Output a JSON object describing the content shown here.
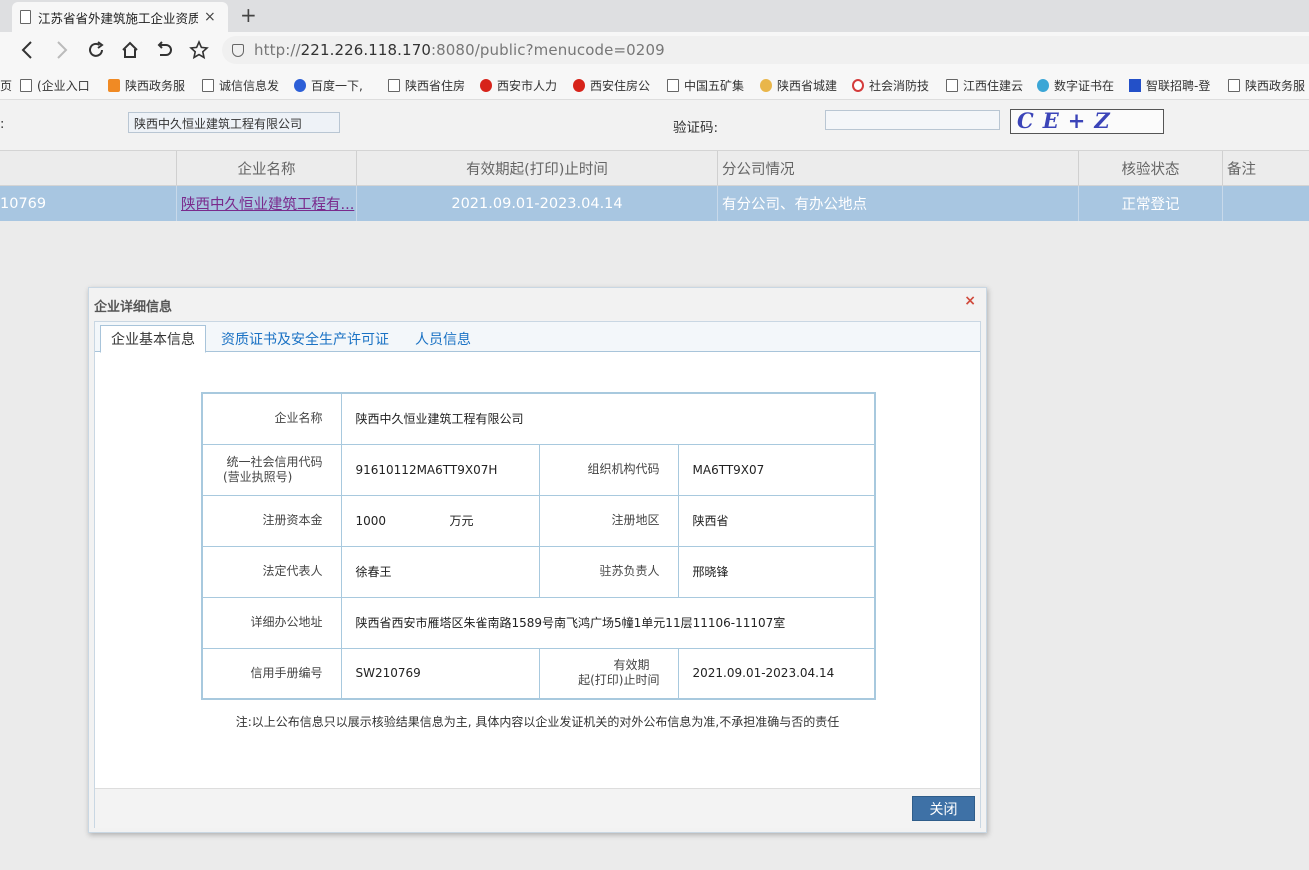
{
  "browser": {
    "tab_title": "江苏省省外建筑施工企业资质",
    "tab_close": "×",
    "new_tab": "+",
    "url_prefix": "http://",
    "url_host": "221.226.118.170",
    "url_rest": ":8080/public?menucode=0209",
    "bookmarks": [
      {
        "label": "(企业入口",
        "icon": "doc-icon"
      },
      {
        "label": "陕西政务服",
        "icon": "orange-icon"
      },
      {
        "label": "诚信信息发",
        "icon": "doc-icon"
      },
      {
        "label": "百度一下,",
        "icon": "paw-icon"
      },
      {
        "label": "陕西省住房",
        "icon": "doc-icon"
      },
      {
        "label": "西安市人力",
        "icon": "emblem-icon"
      },
      {
        "label": "西安住房公",
        "icon": "emblem-icon"
      },
      {
        "label": "中国五矿集",
        "icon": "doc-icon"
      },
      {
        "label": "陕西省城建",
        "icon": "swirl-icon"
      },
      {
        "label": "社会消防技",
        "icon": "fire-icon"
      },
      {
        "label": "江西住建云",
        "icon": "doc-icon"
      },
      {
        "label": "数字证书在",
        "icon": "cert-icon"
      },
      {
        "label": "智联招聘-登",
        "icon": "zl-icon"
      },
      {
        "label": "陕西政务服",
        "icon": "doc-icon"
      }
    ]
  },
  "search": {
    "label": ":",
    "company_value": "陕西中久恒业建筑工程有限公司",
    "captcha_label": "验证码:",
    "captcha_text": "CE+Z"
  },
  "results": {
    "headers": [
      "企业名称",
      "有效期起(打印)止时间",
      "分公司情况",
      "核验状态",
      "备注"
    ],
    "row": {
      "id": "10769",
      "name": "陕西中久恒业建筑工程有...",
      "period": "2021.09.01-2023.04.14",
      "branch": "有分公司、有办公地点",
      "status": "正常登记",
      "remark": ""
    }
  },
  "dialog": {
    "title": "企业详细信息",
    "close_icon": "×",
    "tabs": [
      "企业基本信息",
      "资质证书及安全生产许可证",
      "人员信息"
    ],
    "fields": {
      "name_label": "企业名称",
      "name_value": "陕西中久恒业建筑工程有限公司",
      "credit_label_1": "统一社会信用代码",
      "credit_label_2": "(营业执照号)",
      "credit_value": "91610112MA6TT9X07H",
      "org_label": "组织机构代码",
      "org_value": "MA6TT9X07",
      "capital_label": "注册资本金",
      "capital_value": "1000",
      "capital_unit": "万元",
      "region_label": "注册地区",
      "region_value": "陕西省",
      "legal_label": "法定代表人",
      "legal_value": "徐春王",
      "resident_label": "驻苏负责人",
      "resident_value": "邢晓锋",
      "address_label": "详细办公地址",
      "address_value": "陕西省西安市雁塔区朱雀南路1589号南飞鸿广场5幢1单元11层11106-11107室",
      "manual_label": "信用手册编号",
      "manual_value": "SW210769",
      "validity_label_1": "有效期",
      "validity_label_2": "起(打印)止时间",
      "validity_value": "2021.09.01-2023.04.14"
    },
    "note": "注:以上公布信息只以展示核验结果信息为主, 具体内容以企业发证机关的对外公布信息为准,不承担准确与否的责任",
    "close_button": "关闭"
  }
}
